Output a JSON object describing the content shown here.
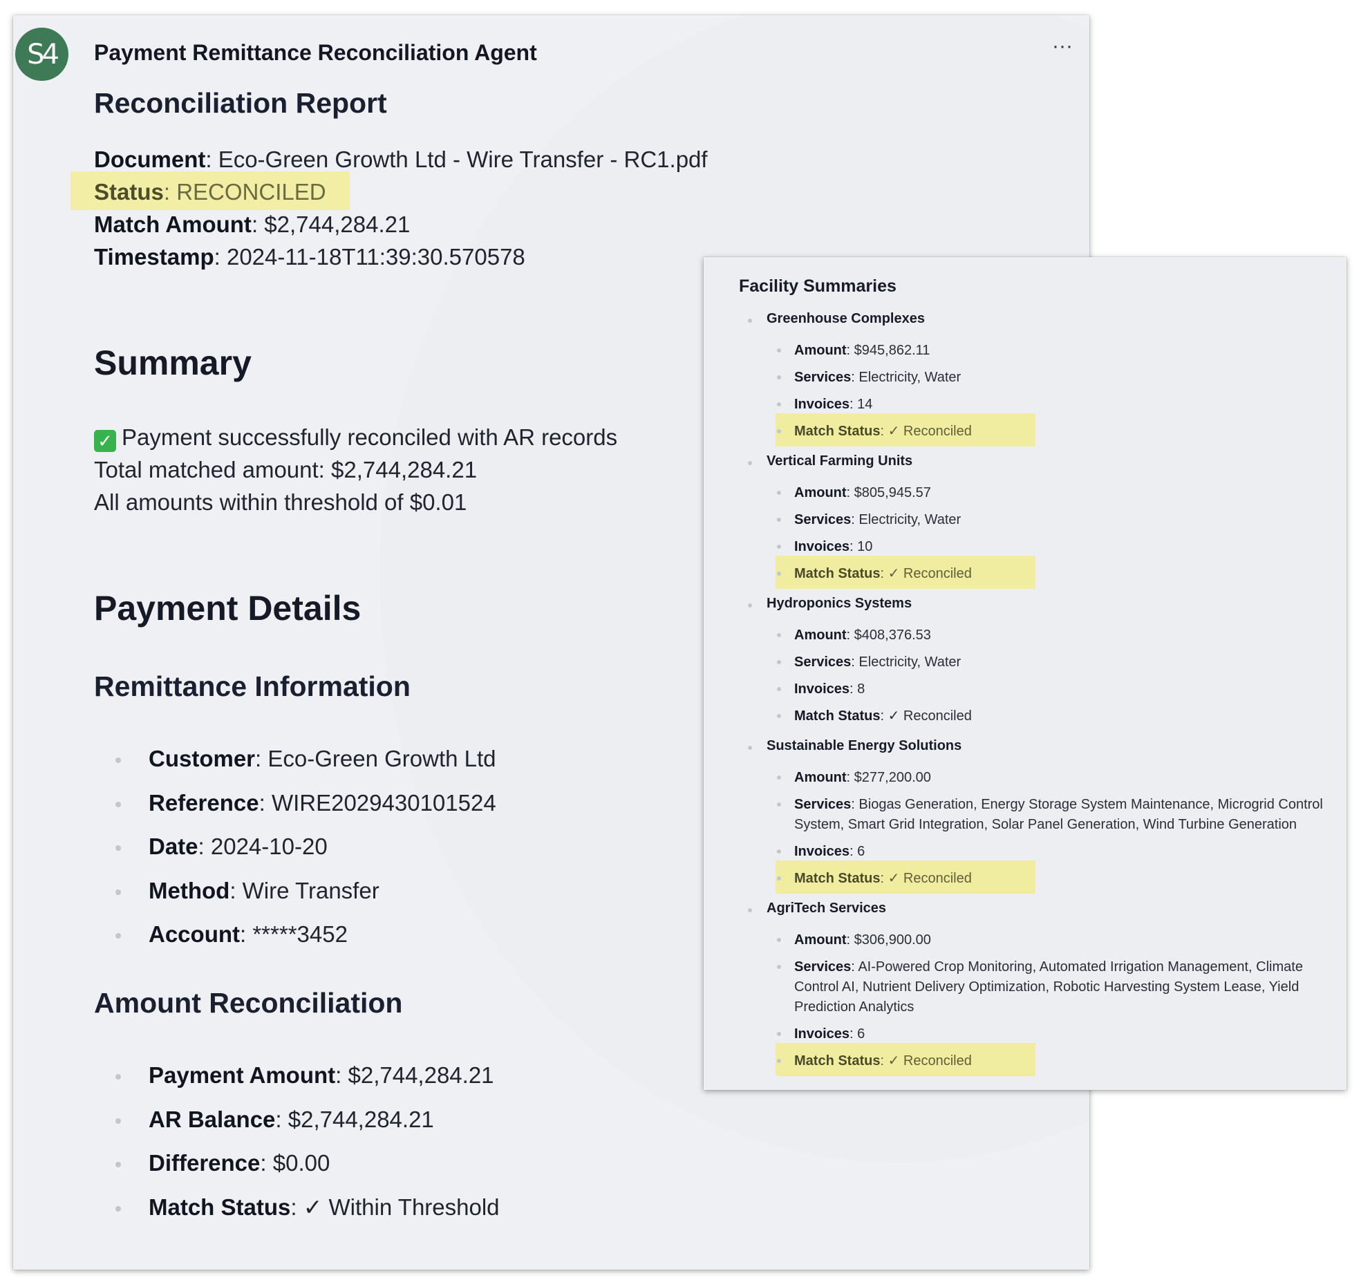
{
  "agent": {
    "avatar_text": "S4",
    "name": "Payment Remittance Reconciliation Agent",
    "more_menu": "···"
  },
  "report": {
    "title": "Reconciliation Report",
    "document_label": "Document",
    "document_value": "Eco-Green Growth Ltd - Wire Transfer - RC1.pdf",
    "status_label": "Status",
    "status_value": "RECONCILED",
    "match_amount_label": "Match Amount",
    "match_amount_value": "$2,744,284.21",
    "timestamp_label": "Timestamp",
    "timestamp_value": "2024-11-18T11:39:30.570578"
  },
  "summary": {
    "heading": "Summary",
    "line1": "Payment successfully reconciled with AR records",
    "line2": "Total matched amount: $2,744,284.21",
    "line3": "All amounts within threshold of $0.01"
  },
  "payment_details": {
    "heading": "Payment Details",
    "remittance_heading": "Remittance Information",
    "remittance": [
      {
        "label": "Customer",
        "value": "Eco-Green Growth Ltd"
      },
      {
        "label": "Reference",
        "value": "WIRE2029430101524"
      },
      {
        "label": "Date",
        "value": "2024-10-20"
      },
      {
        "label": "Method",
        "value": "Wire Transfer"
      },
      {
        "label": "Account",
        "value": "*****3452"
      }
    ],
    "amount_heading": "Amount Reconciliation",
    "amounts": [
      {
        "label": "Payment Amount",
        "value": "$2,744,284.21"
      },
      {
        "label": "AR Balance",
        "value": "$2,744,284.21"
      },
      {
        "label": "Difference",
        "value": "$0.00"
      },
      {
        "label": "Match Status",
        "value": "✓ Within Threshold"
      }
    ]
  },
  "facility_summaries": {
    "title": "Facility Summaries",
    "labels": {
      "amount": "Amount",
      "services": "Services",
      "invoices": "Invoices",
      "match_status": "Match Status"
    },
    "facilities": [
      {
        "name": "Greenhouse Complexes",
        "amount": "$945,862.11",
        "services": "Electricity, Water",
        "invoices": "14",
        "match_status": "✓ Reconciled"
      },
      {
        "name": "Vertical Farming Units",
        "amount": "$805,945.57",
        "services": "Electricity, Water",
        "invoices": "10",
        "match_status": "✓ Reconciled"
      },
      {
        "name": "Hydroponics Systems",
        "amount": "$408,376.53",
        "services": "Electricity, Water",
        "invoices": "8",
        "match_status": "✓ Reconciled"
      },
      {
        "name": "Sustainable Energy Solutions",
        "amount": "$277,200.00",
        "services": "Biogas Generation, Energy Storage System Maintenance, Microgrid Control System, Smart Grid Integration, Solar Panel Generation, Wind Turbine Generation",
        "invoices": "6",
        "match_status": "✓ Reconciled"
      },
      {
        "name": "AgriTech Services",
        "amount": "$306,900.00",
        "services": "AI-Powered Crop Monitoring, Automated Irrigation Management, Climate Control AI, Nutrient Delivery Optimization, Robotic Harvesting System Lease, Yield Prediction Analytics",
        "invoices": "6",
        "match_status": "✓ Reconciled"
      }
    ]
  },
  "colors": {
    "highlight": "#f1eda0",
    "avatar": "#3d7a55",
    "check": "#37b24d"
  }
}
